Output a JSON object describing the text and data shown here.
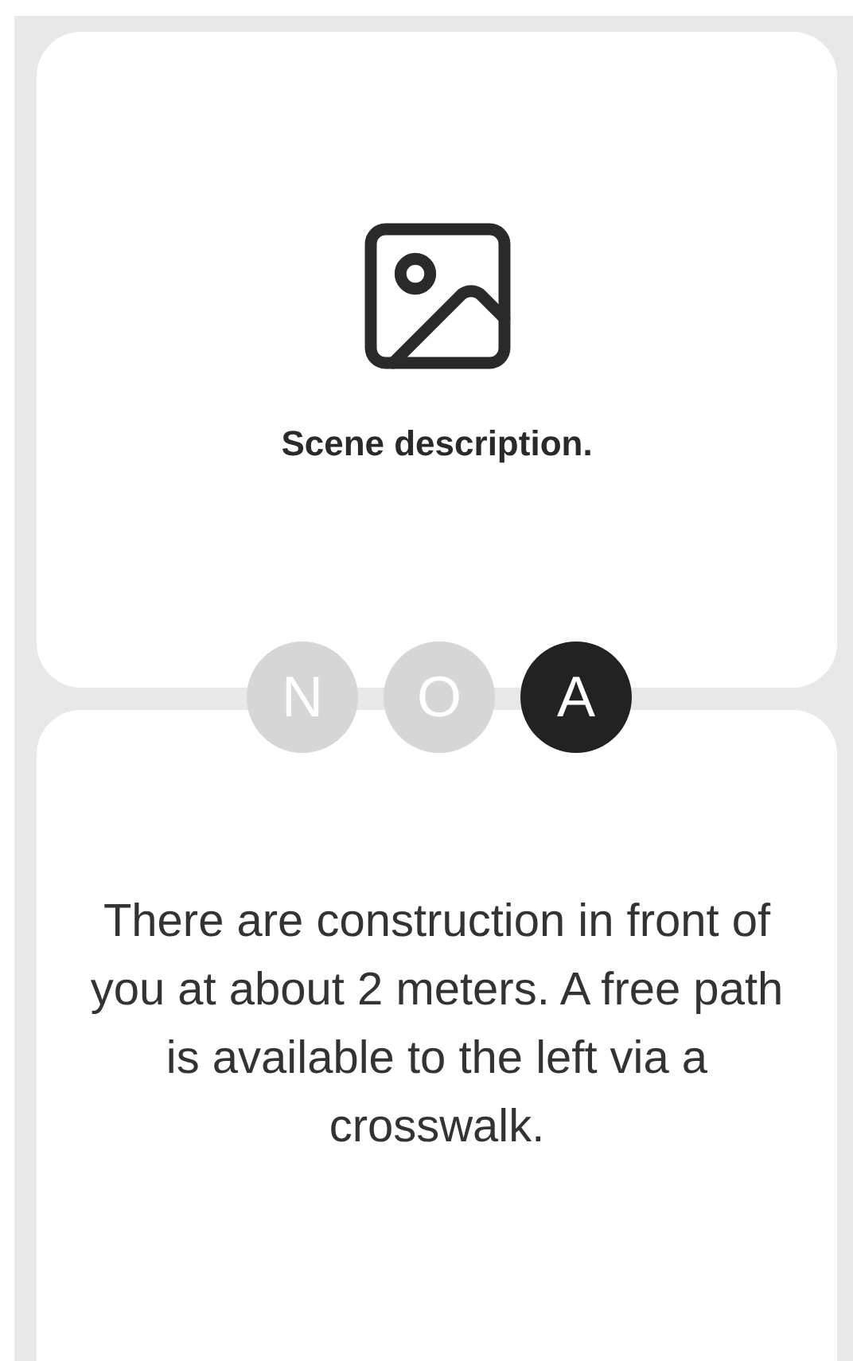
{
  "scene_card": {
    "caption": "Scene description."
  },
  "modes": [
    {
      "label": "N",
      "selected": false
    },
    {
      "label": "O",
      "selected": false
    },
    {
      "label": "A",
      "selected": true
    }
  ],
  "description": {
    "text": "There are construction in front of you at about 2 meters. A free path is available to the left via a crosswalk."
  }
}
